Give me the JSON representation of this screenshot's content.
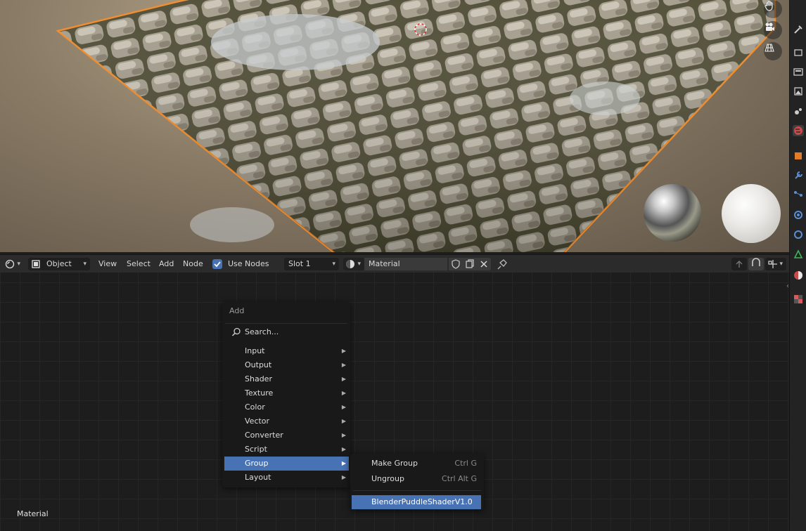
{
  "header": {
    "mode_label": "Object",
    "menus": [
      "View",
      "Select",
      "Add",
      "Node"
    ],
    "use_nodes_label": "Use Nodes",
    "use_nodes_checked": true,
    "slot_label": "Slot 1",
    "material_name": "Material"
  },
  "add_menu": {
    "title": "Add",
    "search_label": "Search...",
    "items": [
      {
        "label": "Input"
      },
      {
        "label": "Output"
      },
      {
        "label": "Shader"
      },
      {
        "label": "Texture"
      },
      {
        "label": "Color"
      },
      {
        "label": "Vector"
      },
      {
        "label": "Converter"
      },
      {
        "label": "Script"
      },
      {
        "label": "Group",
        "active": true
      },
      {
        "label": "Layout"
      }
    ]
  },
  "group_submenu": {
    "items": [
      {
        "label": "Make Group",
        "shortcut": "Ctrl G"
      },
      {
        "label": "Ungroup",
        "shortcut": "Ctrl Alt G"
      },
      {
        "label": "BlenderPuddleShaderV1.0",
        "active": true
      }
    ]
  },
  "canvas": {
    "material_label": "Material"
  },
  "icons": {
    "viewport_nav": [
      "hand-icon",
      "camera-icon",
      "grid-icon"
    ],
    "header": [
      "editor-type-icon",
      "object-mode-icon",
      "checkbox-icon",
      "material-sphere-icon",
      "fake-user-shield-icon",
      "duplicate-icon",
      "close-icon",
      "pin-icon",
      "parent-node-icon",
      "snap-icon",
      "snap-settings-icon"
    ],
    "search": "search-icon"
  },
  "colors": {
    "accent": "#4772b3",
    "selection_outline": "#f08c2c",
    "menu_bg": "#191919",
    "header_bg": "#2b2b2b"
  }
}
